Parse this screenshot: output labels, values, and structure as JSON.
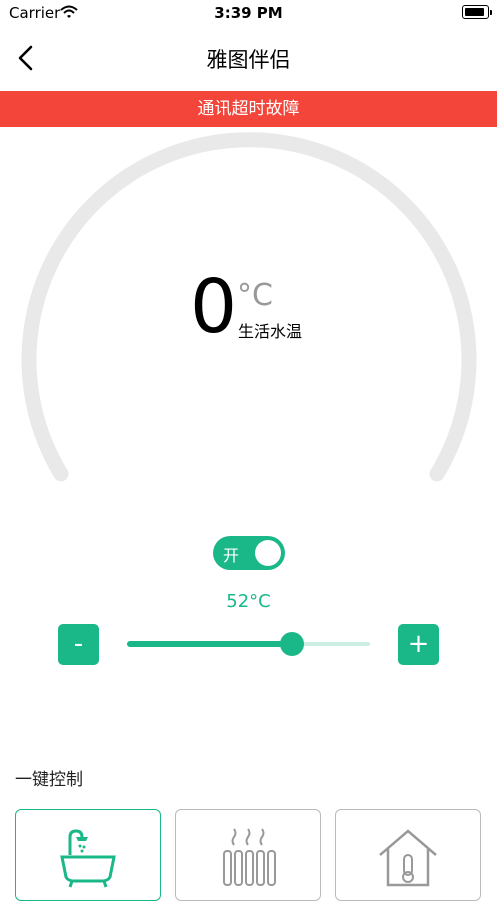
{
  "status_bar": {
    "carrier": "Carrier",
    "time": "3:39 PM"
  },
  "nav": {
    "title": "雅图伴侣"
  },
  "alert": {
    "text": "通讯超时故障"
  },
  "gauge": {
    "value": "0",
    "unit": "°C",
    "label": "生活水温"
  },
  "power_toggle": {
    "label": "开",
    "on": true
  },
  "set_point": {
    "text": "52°C",
    "level_fraction": 0.68
  },
  "controls": {
    "minus_label": "-",
    "plus_label": "+"
  },
  "quick_control": {
    "title": "一键控制",
    "cards": [
      {
        "icon": "bathtub-shower-icon",
        "active": true
      },
      {
        "icon": "radiator-icon",
        "active": false
      },
      {
        "icon": "house-thermometer-icon",
        "active": false
      }
    ]
  },
  "colors": {
    "accent": "#1ab889",
    "alert": "#f34539",
    "gauge_track": "#e9e9e9"
  }
}
